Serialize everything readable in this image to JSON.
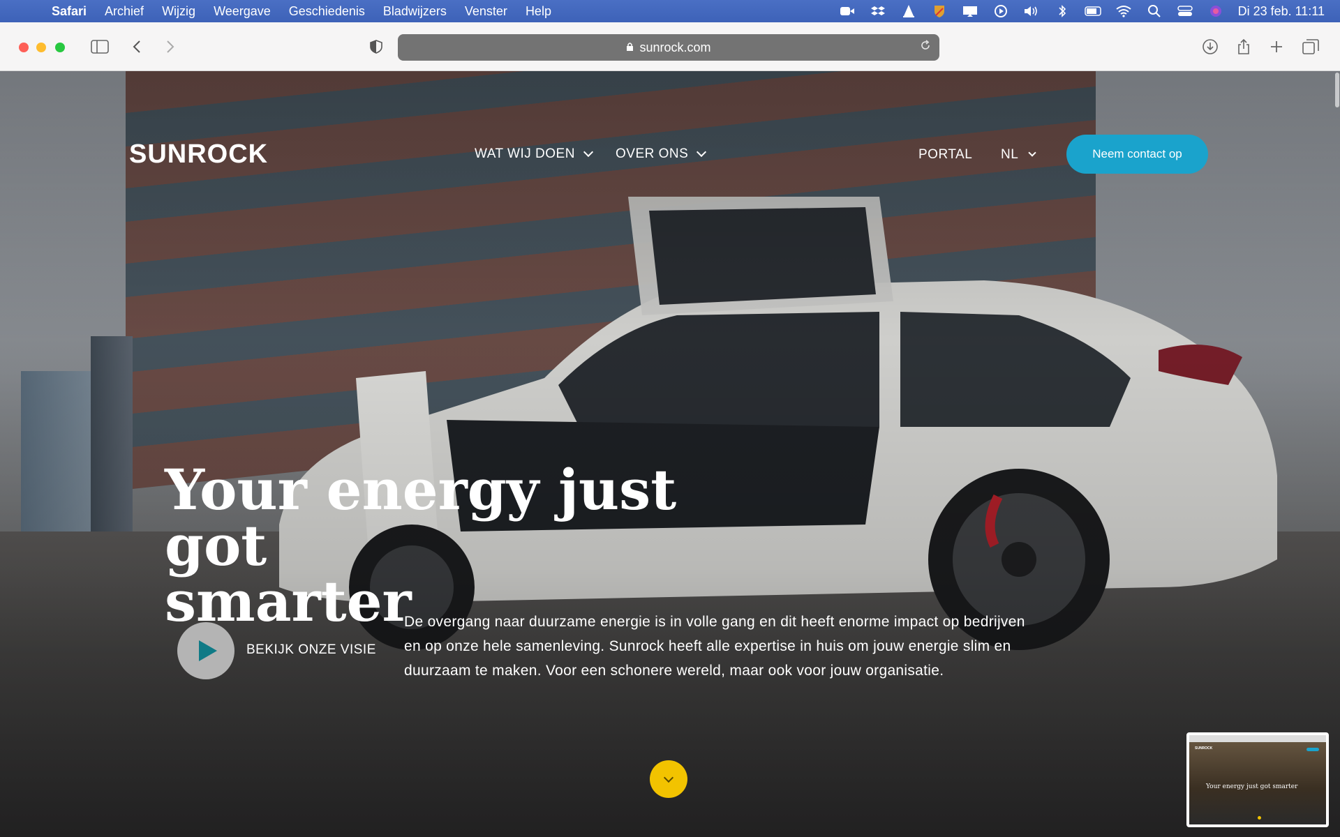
{
  "menubar": {
    "app": "Safari",
    "items": [
      "Archief",
      "Wijzig",
      "Weergave",
      "Geschiedenis",
      "Bladwijzers",
      "Venster",
      "Help"
    ],
    "status_icons": [
      "zoom-icon",
      "dropbox-icon",
      "vlc-icon",
      "security-icon",
      "display-icon",
      "play-icon",
      "volume-icon",
      "bluetooth-icon",
      "battery-icon",
      "wifi-icon",
      "search-icon",
      "control-center-icon",
      "siri-icon"
    ],
    "clock": "Di 23 feb.  11:11"
  },
  "toolbar": {
    "url": "sunrock.com"
  },
  "page": {
    "logo": "SUNROCK",
    "nav": {
      "what_we_do": "WAT WIJ DOEN",
      "about": "OVER ONS",
      "portal": "PORTAL",
      "language": "NL"
    },
    "contact_button": "Neem contact op",
    "headline_line1": "Your energy just got",
    "headline_line2": "smarter",
    "video_label": "BEKIJK ONZE VISIE",
    "intro": "De overgang naar duurzame energie is in volle gang en dit heeft enorme impact op bedrijven en op onze hele samenleving. Sunrock heeft alle expertise in huis om jouw energie slim en duurzaam te maken. Voor een schonere wereld, maar ook voor jouw organisatie.",
    "accent_color": "#1aa3cc",
    "scroll_color": "#f2c300"
  },
  "thumbnail": {
    "logo": "SUNROCK",
    "headline": "Your energy just got smarter"
  }
}
